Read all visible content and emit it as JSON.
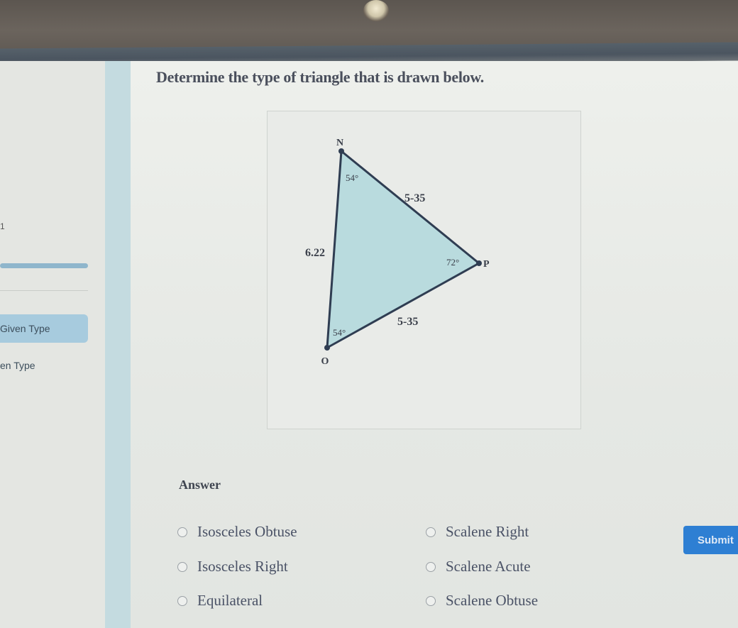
{
  "sidebar": {
    "marker_text": "1",
    "active_item": "Given Type",
    "items": [
      "Given Type",
      "en Type"
    ]
  },
  "question": {
    "prompt": "Determine the type of triangle that is drawn below."
  },
  "figure": {
    "fill_color": "#b9dbde",
    "stroke_color": "#2f3d52",
    "vertices": [
      {
        "label": "N",
        "angle": "54°"
      },
      {
        "label": "P",
        "angle": "72°"
      },
      {
        "label": "O",
        "angle": "54°"
      }
    ],
    "sides": [
      {
        "between": "N-P",
        "length": "5-35"
      },
      {
        "between": "P-O",
        "length": "5-35"
      },
      {
        "between": "N-O",
        "length": "6.22"
      }
    ]
  },
  "answer": {
    "title": "Answer",
    "options": [
      "Isosceles Obtuse",
      "Scalene Right",
      "Isosceles Right",
      "Scalene Acute",
      "Equilateral",
      "Scalene Obtuse"
    ],
    "selected": null
  },
  "submit": {
    "label": "Submit",
    "color": "#2e7fd3"
  }
}
